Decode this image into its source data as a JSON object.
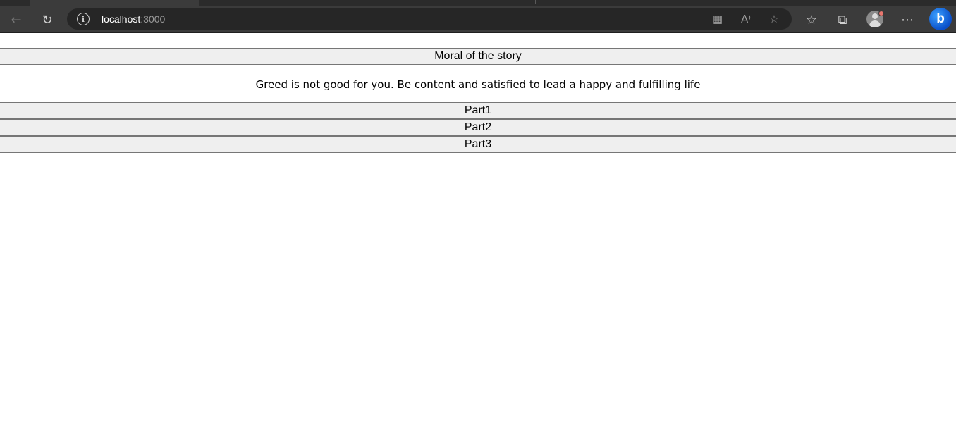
{
  "browser": {
    "url_host": "localhost",
    "url_port": ":3000",
    "icons": {
      "back": "arrow-left-icon",
      "refresh": "refresh-icon",
      "site_info": "info-icon",
      "app_available": "app-grid-icon",
      "read_aloud": "read-aloud-icon",
      "favorite": "star-icon",
      "favorites": "favorites-list-icon",
      "collections": "collections-icon",
      "profile": "avatar-icon",
      "more": "more-icon",
      "bing": "bing-icon"
    },
    "colors": {
      "chrome": "#3b3b3b",
      "addressbar": "#262626",
      "bing": "#1a73e8"
    }
  },
  "accordion": {
    "sections": [
      {
        "header": "Moral of the story",
        "content": "Greed is not good for you. Be content and satisfied to lead a happy and fulfilling life",
        "expanded": true
      },
      {
        "header": "Part1",
        "expanded": false
      },
      {
        "header": "Part2",
        "expanded": false
      },
      {
        "header": "Part3",
        "expanded": false
      }
    ]
  }
}
